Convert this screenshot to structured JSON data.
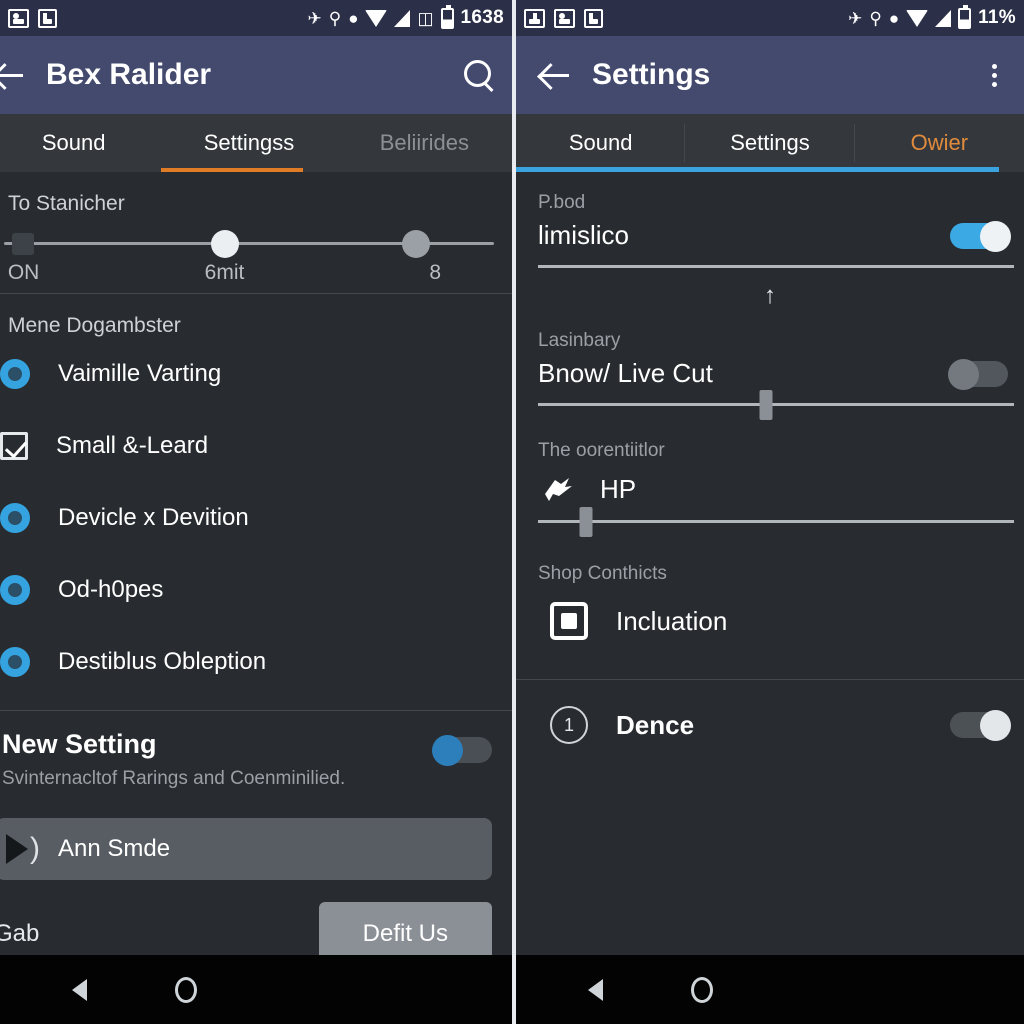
{
  "left": {
    "statusbar": {
      "icons": [
        "image-notification-icon",
        "info-notification-icon"
      ],
      "right_icons": [
        "airplane-cut-icon",
        "bluetooth-person-icon",
        "dnd-icon",
        "wifi-icon",
        "signal-icon",
        "vibrate-icon",
        "battery-icon"
      ],
      "clock": "1638"
    },
    "appbar": {
      "title": "Bex Ralider",
      "back": "back-arrow",
      "search": "search-icon"
    },
    "tabs": [
      {
        "label": "Sound",
        "state": "inactive"
      },
      {
        "label": "Settingss",
        "state": "active"
      },
      {
        "label": "Beliirides",
        "state": "disabled"
      }
    ],
    "slider_section": {
      "heading": "To Stanicher",
      "labels": [
        "ON",
        "6mit",
        "8"
      ],
      "thumb_positions": [
        45,
        84
      ]
    },
    "options_section": {
      "heading": "Mene Dogambster",
      "items": [
        {
          "label": "Vaimille Varting",
          "control": "radio",
          "checked": true
        },
        {
          "label": "Small &-Leard",
          "control": "checkbox",
          "checked": true
        },
        {
          "label": "Devicle x Devition",
          "control": "radio",
          "checked": true
        },
        {
          "label": "Od-h0pes",
          "control": "radio",
          "checked": true
        },
        {
          "label": "Destiblus Obleption",
          "control": "radio",
          "checked": true
        }
      ]
    },
    "new_setting": {
      "title": "New Setting",
      "subtitle": "Svinternacltof Rarings and Coenminilied.",
      "toggle": "off"
    },
    "pill": {
      "label": "Ann Smde",
      "icon": "play-icon"
    },
    "footer": {
      "label": "Gab",
      "button": "Defit Us"
    },
    "navbar": {
      "back": "nav-back-icon",
      "home": "nav-home-icon"
    }
  },
  "right": {
    "statusbar": {
      "icons": [
        "sd-card-icon",
        "image-notification-icon",
        "info-notification-icon"
      ],
      "right_icons": [
        "airplane-cut-icon",
        "bluetooth-person-icon",
        "dnd-icon",
        "wifi-icon",
        "signal-icon",
        "battery-icon"
      ],
      "battery": "11%"
    },
    "appbar": {
      "title": "Settings",
      "back": "back-arrow",
      "overflow": "more-vert-icon"
    },
    "tabs": [
      {
        "label": "Sound",
        "state": "inactive"
      },
      {
        "label": "Settings",
        "state": "inactive"
      },
      {
        "label": "Owier",
        "state": "active"
      }
    ],
    "section_1": {
      "heading": "P.bod",
      "row_title": "limislico",
      "toggle": "on",
      "slider_value": 0,
      "hint_icon": "up-arrow-icon"
    },
    "section_2": {
      "heading": "Lasinbary",
      "row_title": "Bnow/ Live Cut",
      "toggle": "off",
      "slider_value": 48
    },
    "section_3": {
      "heading": "The oorentiitlor",
      "row_title": "HP",
      "icon": "bird-icon",
      "slider_value": 10
    },
    "section_4": {
      "heading": "Shop Conthicts",
      "row_title": "Incluation",
      "control": "square-checkbox"
    },
    "section_5": {
      "badge": "1",
      "row_title": "Dence",
      "toggle": "off-light"
    },
    "navbar": {
      "back": "nav-back-icon",
      "home": "nav-home-icon"
    }
  },
  "colors": {
    "appbar": "#434a6e",
    "statusbar": "#2b2f47",
    "background": "#282c30",
    "accent_orange": "#e07b26",
    "accent_blue": "#3aa3e0",
    "tabbar": "#34383c"
  }
}
